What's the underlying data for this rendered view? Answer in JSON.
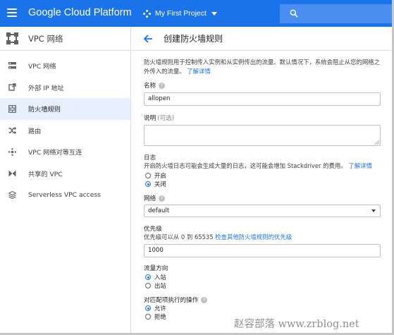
{
  "topbar": {
    "brand": "Google Cloud Platform",
    "project_name": "My First Project",
    "bg_color": "#1a73e8"
  },
  "sidebar": {
    "title": "VPC 网络",
    "items": [
      {
        "label": "VPC 网络",
        "icon": "vpc-networks-icon"
      },
      {
        "label": "外部 IP 地址",
        "icon": "external-ip-icon"
      },
      {
        "label": "防火墙规则",
        "icon": "firewall-icon",
        "active": true
      },
      {
        "label": "路由",
        "icon": "routes-icon"
      },
      {
        "label": "VPC 网络对等互连",
        "icon": "peering-icon"
      },
      {
        "label": "共享的 VPC",
        "icon": "shared-vpc-icon"
      },
      {
        "label": "Serverless VPC access",
        "icon": "serverless-icon"
      }
    ]
  },
  "main": {
    "title": "创建防火墙规则",
    "intro_text": "防火墙规则用于控制传入实例和从实例传出的流量。默认情况下，系统会阻止从您的网络之外传入的流量。",
    "intro_link": "了解详情",
    "name": {
      "label": "名称",
      "value": "allopen"
    },
    "description": {
      "label": "说明",
      "optional": "(可选)",
      "value": ""
    },
    "logs": {
      "label": "日志",
      "text": "开启防火墙日志可能会生成大量的日志，这可能会增加 Stackdriver 的费用。",
      "link": "了解详情",
      "options": [
        {
          "label": "开启",
          "selected": false
        },
        {
          "label": "关闭",
          "selected": true
        }
      ]
    },
    "network": {
      "label": "网络",
      "value": "default"
    },
    "priority": {
      "label": "优先级",
      "text": "优先级可以从 0 到 65535",
      "link": "检查其他防火墙规则的优先级",
      "value": "1000"
    },
    "direction": {
      "label": "流量方向",
      "options": [
        {
          "label": "入站",
          "selected": true
        },
        {
          "label": "出站",
          "selected": false
        }
      ]
    },
    "action": {
      "label": "对匹配项执行的操作",
      "options": [
        {
          "label": "允许",
          "selected": true
        },
        {
          "label": "拒绝",
          "selected": false
        }
      ]
    }
  },
  "watermark": "赵容部落 www.zrblog.net"
}
